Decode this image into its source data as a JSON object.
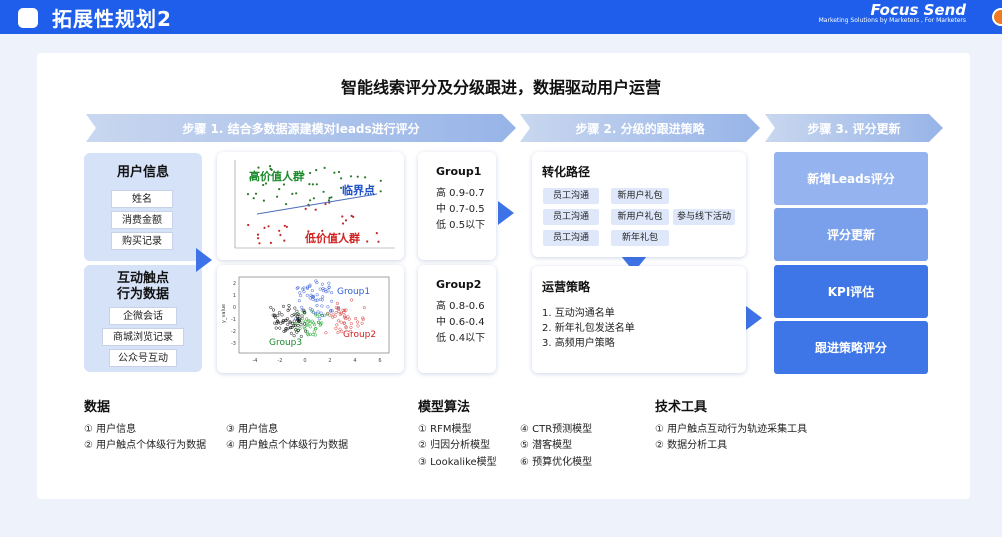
{
  "header": {
    "title": "拓展性规划2",
    "brand_name": "Focus Send",
    "brand_tagline": "Marketing Solutions by Marketers , For Marketers"
  },
  "main_title": "智能线索评分及分级跟进，数据驱动用户运营",
  "steps": [
    "步骤 1. 结合多数据源建模对leads进行评分",
    "步骤 2. 分级的跟进策略",
    "步骤 3. 评分更新"
  ],
  "user_info": {
    "title": "用户信息",
    "items": [
      "姓名",
      "消费金额",
      "购买记录"
    ]
  },
  "interaction": {
    "title_line1": "互动触点",
    "title_line2": "行为数据",
    "items": [
      "企微会话",
      "商城浏览记录",
      "公众号互动"
    ]
  },
  "chart1_labels": {
    "high": "高价值人群",
    "critical": "临界点",
    "low": "低价值人群"
  },
  "chart2_labels": {
    "group1": "Group1",
    "group2": "Group2",
    "group3": "Group3",
    "ylabel": "y_value",
    "xticks": [
      "-4",
      "-2",
      "0",
      "2",
      "4",
      "6"
    ],
    "yticks": [
      "2",
      "1",
      "0",
      "-1",
      "-2",
      "-3"
    ]
  },
  "group1": {
    "title": "Group1",
    "lines": [
      "高 0.9-0.7",
      "中 0.7-0.5",
      "低 0.5以下"
    ]
  },
  "group2": {
    "title": "Group2",
    "lines": [
      "高 0.8-0.6",
      "中 0.6-0.4",
      "低 0.4以下"
    ]
  },
  "conversion": {
    "title": "转化路径",
    "tags": [
      "员工沟通",
      "新用户礼包",
      "员工沟通",
      "新用户礼包",
      "参与线下活动",
      "员工沟通",
      "新年礼包"
    ]
  },
  "operation": {
    "title": "运营策略",
    "items": [
      "1. 互动沟通名单",
      "2. 新年礼包发送名单",
      "3. 高频用户策略"
    ]
  },
  "right_buttons": [
    "新增Leads评分",
    "评分更新",
    "KPI评估",
    "跟进策略评分"
  ],
  "bottom": {
    "data": {
      "title": "数据",
      "items": [
        "① 用户信息",
        "③ 用户信息",
        "② 用户触点个体级行为数据",
        "④ 用户触点个体级行为数据"
      ]
    },
    "model": {
      "title": "模型算法",
      "items": [
        "① RFM模型",
        "④ CTR预测模型",
        "② 归因分析模型",
        "⑤ 潜客模型",
        "③ Lookalike模型",
        "⑥ 预算优化模型"
      ]
    },
    "tools": {
      "title": "技术工具",
      "items": [
        "① 用户触点互动行为轨迹采集工具",
        "② 数据分析工具"
      ]
    }
  },
  "colors": {
    "primary": "#1e5eea",
    "btn_light": "#8fb0ef",
    "btn_mid": "#6e98ea",
    "btn_dark": "#3d73e6",
    "high_green": "#1a8a2a",
    "low_red": "#d42020",
    "critical_blue": "#1d4fc8"
  }
}
